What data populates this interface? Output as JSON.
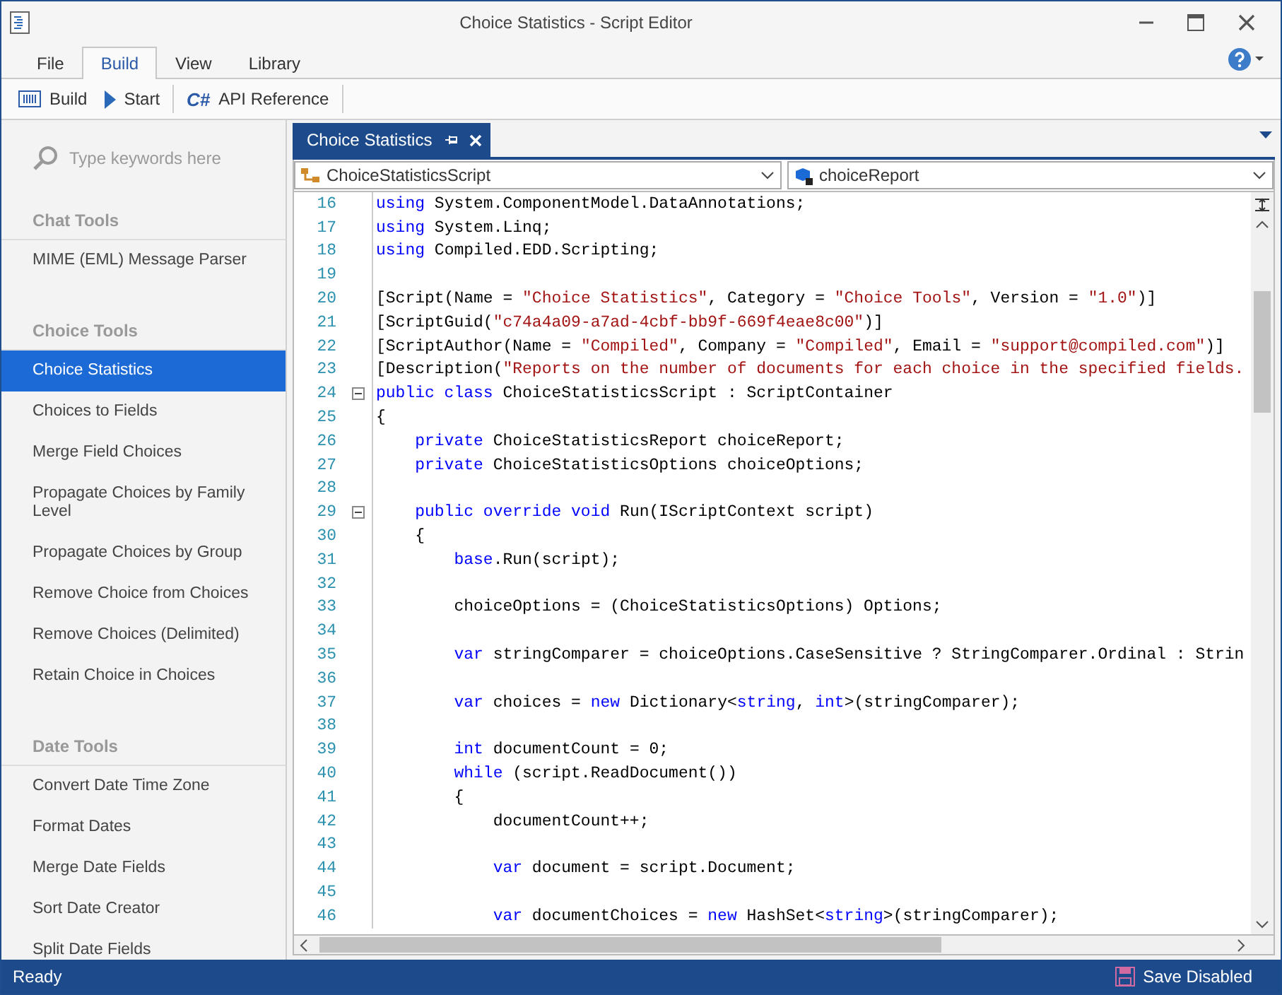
{
  "window": {
    "title": "Choice Statistics - Script Editor"
  },
  "menu_tabs": [
    {
      "label": "File",
      "selected": false
    },
    {
      "label": "Build",
      "selected": true
    },
    {
      "label": "View",
      "selected": false
    },
    {
      "label": "Library",
      "selected": false
    }
  ],
  "toolbar": [
    {
      "kind": "build",
      "label": "Build"
    },
    {
      "kind": "start",
      "label": "Start"
    },
    {
      "kind": "api",
      "icon_text": "C#",
      "label": "API Reference"
    }
  ],
  "sidebar": {
    "search": {
      "placeholder": "Type keywords here"
    },
    "groups": [
      {
        "title": "Chat Tools",
        "items": [
          {
            "label": "MIME (EML) Message Parser",
            "selected": false
          }
        ]
      },
      {
        "title": "Choice Tools",
        "items": [
          {
            "label": "Choice Statistics",
            "selected": true
          },
          {
            "label": "Choices to Fields",
            "selected": false
          },
          {
            "label": "Merge Field Choices",
            "selected": false
          },
          {
            "label": "Propagate Choices by Family Level",
            "selected": false
          },
          {
            "label": "Propagate Choices by Group",
            "selected": false
          },
          {
            "label": "Remove Choice from Choices",
            "selected": false
          },
          {
            "label": "Remove Choices (Delimited)",
            "selected": false
          },
          {
            "label": "Retain Choice in Choices",
            "selected": false
          }
        ]
      },
      {
        "title": "Date Tools",
        "items": [
          {
            "label": "Convert Date Time Zone",
            "selected": false
          },
          {
            "label": "Format Dates",
            "selected": false
          },
          {
            "label": "Merge Date Fields",
            "selected": false
          },
          {
            "label": "Sort Date Creator",
            "selected": false
          },
          {
            "label": "Split Date Fields",
            "selected": false
          }
        ]
      }
    ]
  },
  "document_tab": {
    "title": "Choice Statistics"
  },
  "type_selector": {
    "value": "ChoiceStatisticsScript"
  },
  "member_selector": {
    "value": "choiceReport"
  },
  "code_lines": [
    {
      "number": "16",
      "fold": false,
      "tokens": [
        {
          "kind": "keyword",
          "text": "using"
        },
        {
          "kind": "plain",
          "text": " System.ComponentModel.DataAnnotations;"
        }
      ]
    },
    {
      "number": "17",
      "fold": false,
      "tokens": [
        {
          "kind": "keyword",
          "text": "using"
        },
        {
          "kind": "plain",
          "text": " System.Linq;"
        }
      ]
    },
    {
      "number": "18",
      "fold": false,
      "tokens": [
        {
          "kind": "keyword",
          "text": "using"
        },
        {
          "kind": "plain",
          "text": " Compiled.EDD.Scripting;"
        }
      ]
    },
    {
      "number": "19",
      "fold": false
    },
    {
      "number": "20",
      "fold": false,
      "tokens": [
        {
          "kind": "plain",
          "text": "[Script(Name = "
        },
        {
          "kind": "string",
          "text": "\"Choice Statistics\""
        },
        {
          "kind": "plain",
          "text": ", Category = "
        },
        {
          "kind": "string",
          "text": "\"Choice Tools\""
        },
        {
          "kind": "plain",
          "text": ", Version = "
        },
        {
          "kind": "string",
          "text": "\"1.0\""
        },
        {
          "kind": "plain",
          "text": ")]"
        }
      ]
    },
    {
      "number": "21",
      "fold": false,
      "tokens": [
        {
          "kind": "plain",
          "text": "[ScriptGuid("
        },
        {
          "kind": "string",
          "text": "\"c74a4a09-a7ad-4cbf-bb9f-669f4eae8c00\""
        },
        {
          "kind": "plain",
          "text": ")]"
        }
      ]
    },
    {
      "number": "22",
      "fold": false,
      "tokens": [
        {
          "kind": "plain",
          "text": "[ScriptAuthor(Name = "
        },
        {
          "kind": "string",
          "text": "\"Compiled\""
        },
        {
          "kind": "plain",
          "text": ", Company = "
        },
        {
          "kind": "string",
          "text": "\"Compiled\""
        },
        {
          "kind": "plain",
          "text": ", Email = "
        },
        {
          "kind": "string",
          "text": "\"support@compiled.com\""
        },
        {
          "kind": "plain",
          "text": ")]"
        }
      ]
    },
    {
      "number": "23",
      "fold": false,
      "tokens": [
        {
          "kind": "plain",
          "text": "[Description("
        },
        {
          "kind": "string",
          "text": "\"Reports on the number of documents for each choice in the specified fields."
        }
      ]
    },
    {
      "number": "24",
      "fold": true,
      "tokens": [
        {
          "kind": "keyword",
          "text": "public class"
        },
        {
          "kind": "plain",
          "text": " ChoiceStatisticsScript : ScriptContainer"
        }
      ]
    },
    {
      "number": "25",
      "fold": false,
      "tokens": [
        {
          "kind": "plain",
          "text": "{"
        }
      ]
    },
    {
      "number": "26",
      "fold": false,
      "tokens": [
        {
          "kind": "keyword",
          "text": "    private"
        },
        {
          "kind": "plain",
          "text": " ChoiceStatisticsReport choiceReport;"
        }
      ]
    },
    {
      "number": "27",
      "fold": false,
      "tokens": [
        {
          "kind": "keyword",
          "text": "    private"
        },
        {
          "kind": "plain",
          "text": " ChoiceStatisticsOptions choiceOptions;"
        }
      ]
    },
    {
      "number": "28",
      "fold": false
    },
    {
      "number": "29",
      "fold": true,
      "tokens": [
        {
          "kind": "keyword",
          "text": "    public override void"
        },
        {
          "kind": "plain",
          "text": " Run(IScriptContext script)"
        }
      ]
    },
    {
      "number": "30",
      "fold": false,
      "tokens": [
        {
          "kind": "plain",
          "text": "    {"
        }
      ]
    },
    {
      "number": "31",
      "fold": false,
      "tokens": [
        {
          "kind": "keyword",
          "text": "        base"
        },
        {
          "kind": "plain",
          "text": ".Run(script);"
        }
      ]
    },
    {
      "number": "32",
      "fold": false
    },
    {
      "number": "33",
      "fold": false,
      "tokens": [
        {
          "kind": "plain",
          "text": "        choiceOptions = (ChoiceStatisticsOptions) Options;"
        }
      ]
    },
    {
      "number": "34",
      "fold": false
    },
    {
      "number": "35",
      "fold": false,
      "tokens": [
        {
          "kind": "keyword",
          "text": "        var"
        },
        {
          "kind": "plain",
          "text": " stringComparer = choiceOptions.CaseSensitive ? StringComparer.Ordinal : Strin"
        }
      ]
    },
    {
      "number": "36",
      "fold": false
    },
    {
      "number": "37",
      "fold": false,
      "tokens": [
        {
          "kind": "keyword",
          "text": "        var"
        },
        {
          "kind": "plain",
          "text": " choices = "
        },
        {
          "kind": "keyword",
          "text": "new"
        },
        {
          "kind": "plain",
          "text": " Dictionary<"
        },
        {
          "kind": "keyword",
          "text": "string"
        },
        {
          "kind": "plain",
          "text": ", "
        },
        {
          "kind": "keyword",
          "text": "int"
        },
        {
          "kind": "plain",
          "text": ">(stringComparer);"
        }
      ]
    },
    {
      "number": "38",
      "fold": false
    },
    {
      "number": "39",
      "fold": false,
      "tokens": [
        {
          "kind": "keyword",
          "text": "        int"
        },
        {
          "kind": "plain",
          "text": " documentCount = 0;"
        }
      ]
    },
    {
      "number": "40",
      "fold": false,
      "tokens": [
        {
          "kind": "keyword",
          "text": "        while"
        },
        {
          "kind": "plain",
          "text": " (script.ReadDocument())"
        }
      ]
    },
    {
      "number": "41",
      "fold": false,
      "tokens": [
        {
          "kind": "plain",
          "text": "        {"
        }
      ]
    },
    {
      "number": "42",
      "fold": false,
      "tokens": [
        {
          "kind": "plain",
          "text": "            documentCount++;"
        }
      ]
    },
    {
      "number": "43",
      "fold": false
    },
    {
      "number": "44",
      "fold": false,
      "tokens": [
        {
          "kind": "keyword",
          "text": "            var"
        },
        {
          "kind": "plain",
          "text": " document = script.Document;"
        }
      ]
    },
    {
      "number": "45",
      "fold": false
    },
    {
      "number": "46",
      "fold": false,
      "tokens": [
        {
          "kind": "keyword",
          "text": "            var"
        },
        {
          "kind": "plain",
          "text": " documentChoices = "
        },
        {
          "kind": "keyword",
          "text": "new"
        },
        {
          "kind": "plain",
          "text": " HashSet<"
        },
        {
          "kind": "keyword",
          "text": "string"
        },
        {
          "kind": "plain",
          "text": ">(stringComparer);"
        }
      ]
    }
  ],
  "status_bar": {
    "status": "Ready",
    "save_state": "Save Disabled"
  }
}
